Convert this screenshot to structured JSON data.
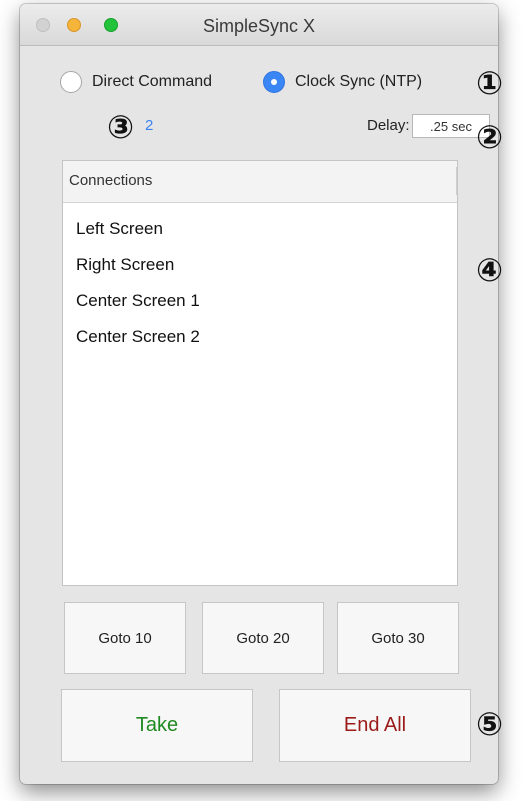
{
  "window": {
    "title": "SimpleSync X"
  },
  "mode": {
    "options": [
      {
        "label": "Direct Command",
        "selected": false
      },
      {
        "label": "Clock Sync (NTP)",
        "selected": true
      }
    ]
  },
  "status": {
    "connection_count": "2"
  },
  "delay": {
    "label": "Delay:",
    "value": ".25 sec"
  },
  "connections": {
    "header": "Connections",
    "items": [
      "Left Screen",
      "Right Screen",
      "Center Screen 1",
      "Center Screen 2"
    ]
  },
  "goto_buttons": [
    "Goto 10",
    "Goto 20",
    "Goto 30"
  ],
  "actions": {
    "take_label": "Take",
    "end_all_label": "End All"
  },
  "annotations": [
    "①",
    "②",
    "③",
    "④",
    "⑤"
  ],
  "colors": {
    "accent": "#3b86f5",
    "count_text": "#3b82f0",
    "take_text": "#1f8a1f",
    "end_all_text": "#9b1b1b"
  }
}
